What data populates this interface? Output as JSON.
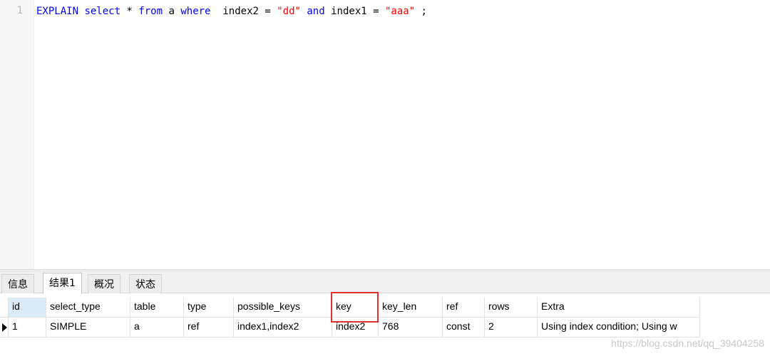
{
  "editor": {
    "line_number": "1",
    "tokens": [
      {
        "text": "EXPLAIN",
        "kind": "kw"
      },
      {
        "text": " ",
        "kind": "plain"
      },
      {
        "text": "select",
        "kind": "kw"
      },
      {
        "text": " * ",
        "kind": "plain"
      },
      {
        "text": "from",
        "kind": "kw"
      },
      {
        "text": " a ",
        "kind": "plain"
      },
      {
        "text": "where",
        "kind": "kw"
      },
      {
        "text": "  index2 = ",
        "kind": "plain"
      },
      {
        "text": "\"dd\"",
        "kind": "str"
      },
      {
        "text": " ",
        "kind": "plain"
      },
      {
        "text": "and",
        "kind": "kw"
      },
      {
        "text": " index1 = ",
        "kind": "plain"
      },
      {
        "text": "\"aaa\"",
        "kind": "str"
      },
      {
        "text": " ;",
        "kind": "plain"
      }
    ]
  },
  "tabs": [
    {
      "label": "信息",
      "active": false
    },
    {
      "label": "结果1",
      "active": true
    },
    {
      "label": "概况",
      "active": false
    },
    {
      "label": "状态",
      "active": false
    }
  ],
  "results": {
    "columns": [
      "id",
      "select_type",
      "table",
      "type",
      "possible_keys",
      "key",
      "key_len",
      "ref",
      "rows",
      "Extra"
    ],
    "rows": [
      [
        "1",
        "SIMPLE",
        "a",
        "ref",
        "index1,index2",
        "index2",
        "768",
        "const",
        "2",
        "Using index condition; Using w"
      ]
    ],
    "highlighted_column": "key"
  },
  "colors": {
    "keyword": "#0000ff",
    "string": "#ff0000",
    "highlight_border": "#e03131",
    "header_selected": "#dcebf8"
  },
  "watermark": "https://blog.csdn.net/qq_39404258"
}
